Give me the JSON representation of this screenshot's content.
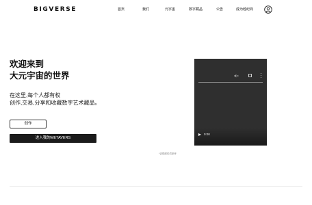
{
  "header": {
    "logo": "BIGVERSE",
    "nav": [
      "首页",
      "我们",
      "元宇宙",
      "数字藏品",
      "公告",
      "成为经纪商"
    ]
  },
  "hero": {
    "title_line1": "欢迎来到",
    "title_line2": "大元宇宙的世界",
    "desc_line1": "在这里,每个人都有权",
    "desc_line2": "创作,交易,分享和收藏数字艺术藏品。",
    "create_button": "创作",
    "enter_button": "进入我的METAVERS"
  },
  "video": {
    "time": "0:00",
    "caption": "*该视频仅供参考"
  },
  "icons": {
    "user": "user-icon",
    "play": "play-icon",
    "mute": "mute-icon",
    "fullscreen": "fullscreen-icon",
    "menu": "more-vertical-icon"
  }
}
